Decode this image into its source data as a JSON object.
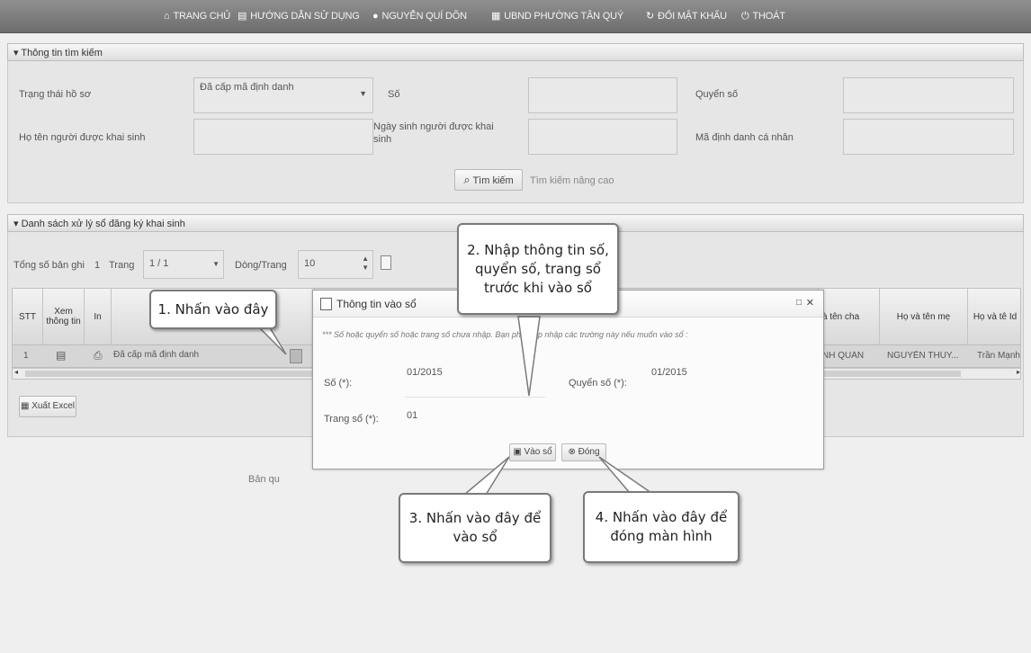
{
  "nav": {
    "home": "TRANG CHỦ",
    "guide": "HƯỚNG DẪN SỬ DỤNG",
    "user": "NGUYỄN QUÍ DÕN",
    "org": "UBND PHƯỜNG TÂN QUÝ",
    "change_password": "ĐỔI MẬT KHẨU",
    "logout": "THOÁT"
  },
  "search": {
    "section_title": "Thông tin tìm kiếm",
    "status_label": "Trạng thái hồ sơ",
    "status_value": "Đã cấp mã định danh",
    "so_label": "Số",
    "quyen_so_label": "Quyển số",
    "name_label": "Họ tên người được khai sinh",
    "dob_label": "Ngày sinh người được khai sinh",
    "personal_id_label": "Mã định danh cá nhân",
    "search_button": "Tìm kiếm",
    "advanced_search": "Tìm kiếm nâng cao"
  },
  "list": {
    "section_title": "Danh sách xử lý sổ đăng ký khai sinh",
    "total_label": "Tổng số bản ghi",
    "total_value": "1",
    "page_label": "Trang",
    "page_value": "1 / 1",
    "rows_label": "Dòng/Trang",
    "rows_value": "10",
    "columns": {
      "stt": "STT",
      "view": "Xem thông tin",
      "print": "In",
      "father": "à tên cha",
      "mother": "Họ và tên mẹ",
      "last": "Họ và tê Id"
    },
    "rows": [
      {
        "stt": "1",
        "status": "Đã cấp mã định danh",
        "father": "NH QUÂN",
        "mother": "NGUYỄN THÚY...",
        "last": "Trần Mạnh"
      }
    ],
    "export_button": "Xuất Excel",
    "footer_text": "Bản qu"
  },
  "dialog": {
    "title": "Thông tin vào sổ",
    "notice": "*** Số hoặc quyển số hoặc trang số chưa nhập. Bạn phải cập nhập các trường này nếu muốn vào sổ :",
    "so_label": "Số (*):",
    "so_value": "01/2015",
    "quyen_so_label": "Quyển số (*):",
    "quyen_so_value": "01/2015",
    "trang_so_label": "Trang sổ (*):",
    "trang_so_value": "01",
    "save_button": "Vào sổ",
    "close_button": "Đóng"
  },
  "callouts": {
    "step1": "1. Nhấn vào đây",
    "step2": "2. Nhập thông tin số, quyển số, trang sổ trước khi vào sổ",
    "step3": "3. Nhấn vào đây để vào sổ",
    "step4": "4. Nhấn vào đây để đóng màn hình"
  }
}
